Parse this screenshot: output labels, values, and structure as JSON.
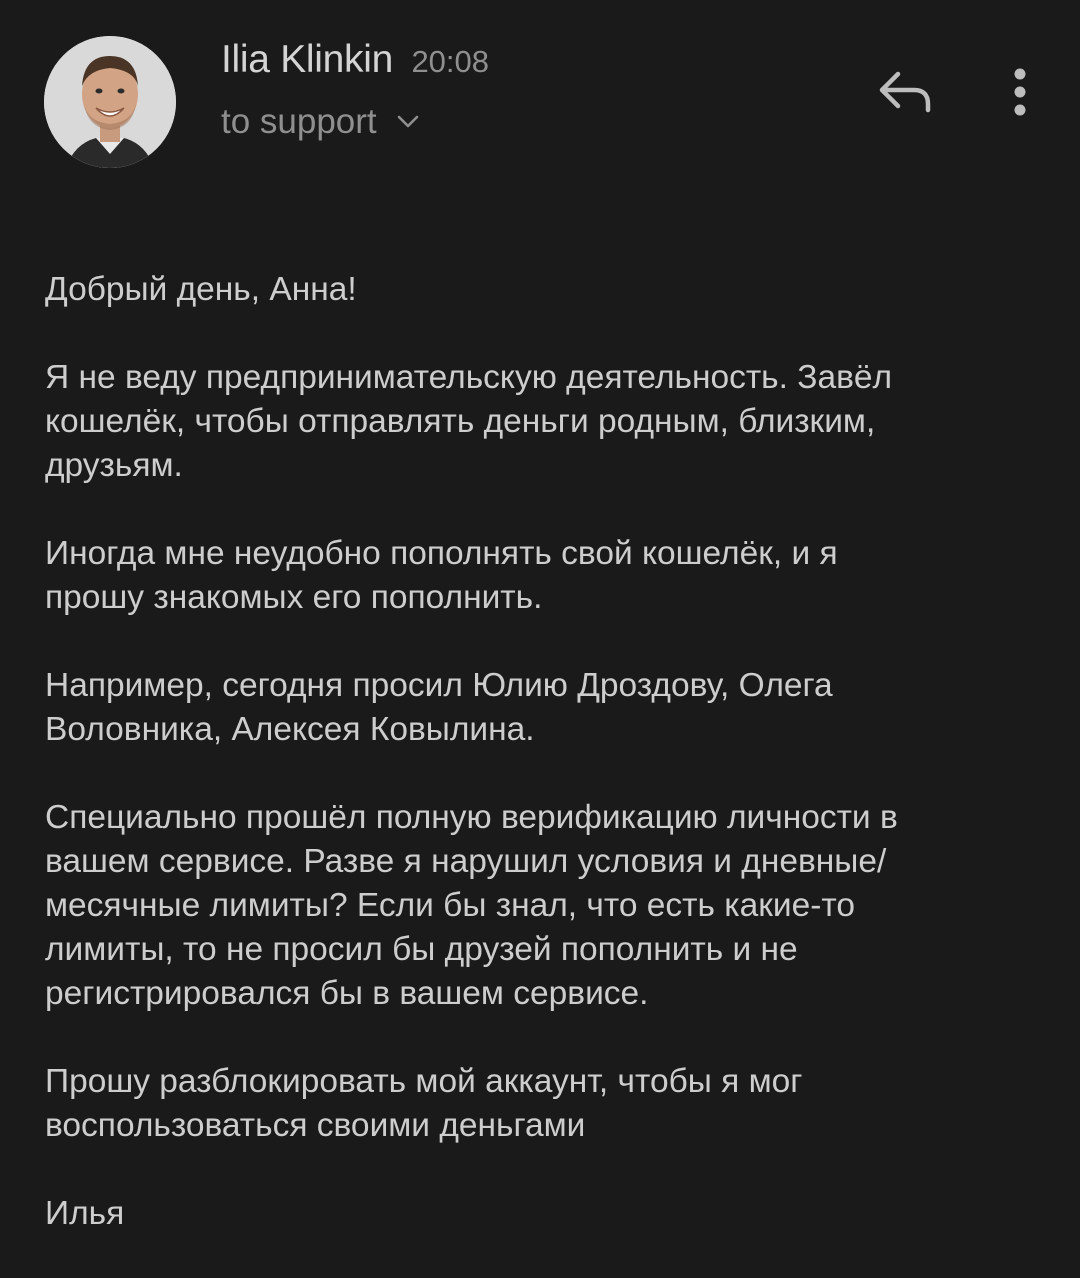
{
  "message": {
    "sender_name": "Ilia Klinkin",
    "time": "20:08",
    "recipient": "to support",
    "icons": {
      "avatar": "avatar-photo",
      "recipient_toggle": "chevron-down-icon",
      "reply": "reply-icon",
      "more": "more-vert-icon"
    },
    "body": {
      "greeting": [
        "Добрый день, Анна!"
      ],
      "p1": [
        "Я не веду предпринимательскую деятельность. Завёл",
        "кошелёк, чтобы отправлять деньги родным, близким,",
        "друзьям."
      ],
      "p2": [
        "Иногда мне неудобно пополнять свой кошелёк, и я",
        "прошу знакомых его пополнить."
      ],
      "p3": [
        "Например, сегодня просил Юлию Дроздову, Олега",
        "Воловника, Алексея Ковылина."
      ],
      "p4": [
        "Специально прошёл полную верификацию личности в",
        "вашем сервисе. Разве я нарушил условия и дневные/",
        "месячные лимиты? Если бы знал, что есть какие-то",
        "лимиты, то не просил бы друзей пополнить и не",
        "регистрировался бы в вашем сервисе."
      ],
      "p5": [
        "Прошу разблокировать мой аккаунт, чтобы я мог",
        "воспользоваться своими деньгами"
      ],
      "signature": [
        "Илья"
      ]
    }
  },
  "colors": {
    "background": "#1a1a1a",
    "primary_text": "#d4d4d4",
    "secondary_text": "#8f8f8f"
  }
}
